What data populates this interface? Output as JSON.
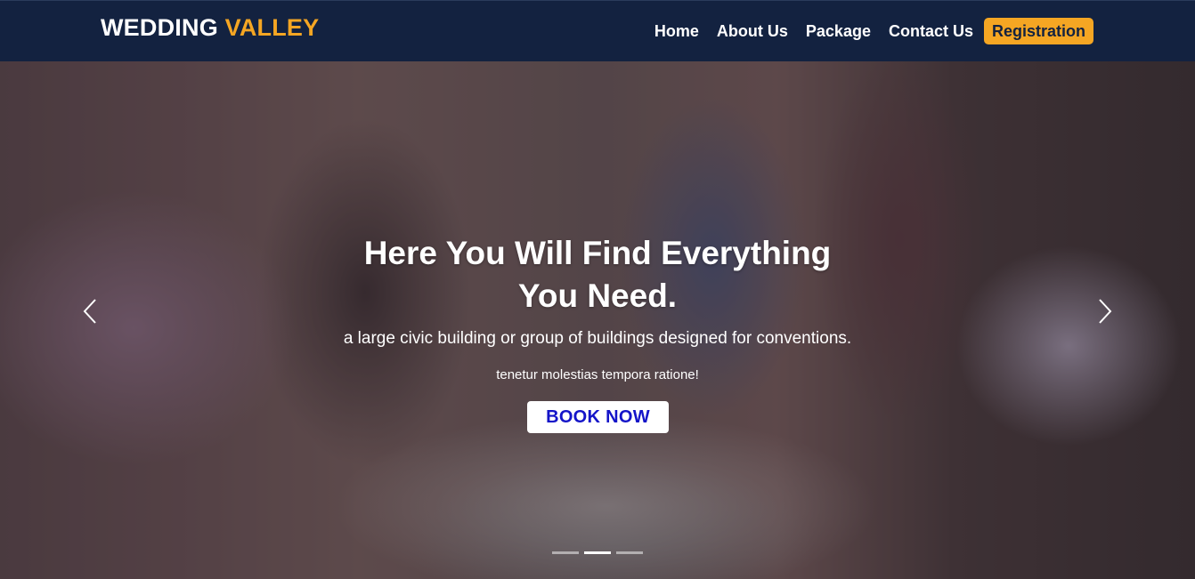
{
  "brand": {
    "name": "WEDDING",
    "accent": "VALLEY"
  },
  "nav": {
    "items": [
      {
        "label": "Home"
      },
      {
        "label": "About Us"
      },
      {
        "label": "Package"
      },
      {
        "label": "Contact Us"
      }
    ],
    "register_label": "Registration"
  },
  "hero": {
    "title": "Here You Will Find Everything You Need.",
    "subtitle": "a large civic building or group of buildings designed for conventions.",
    "subnote": "tenetur molestias tempora ratione!",
    "cta_label": "BOOK NOW",
    "active_slide": 2,
    "slide_count": 3
  },
  "icons": {
    "prev": "chevron-left-icon",
    "next": "chevron-right-icon"
  },
  "colors": {
    "navbar_bg": "#132240",
    "accent": "#f5a623",
    "cta_text": "#1414c8"
  }
}
